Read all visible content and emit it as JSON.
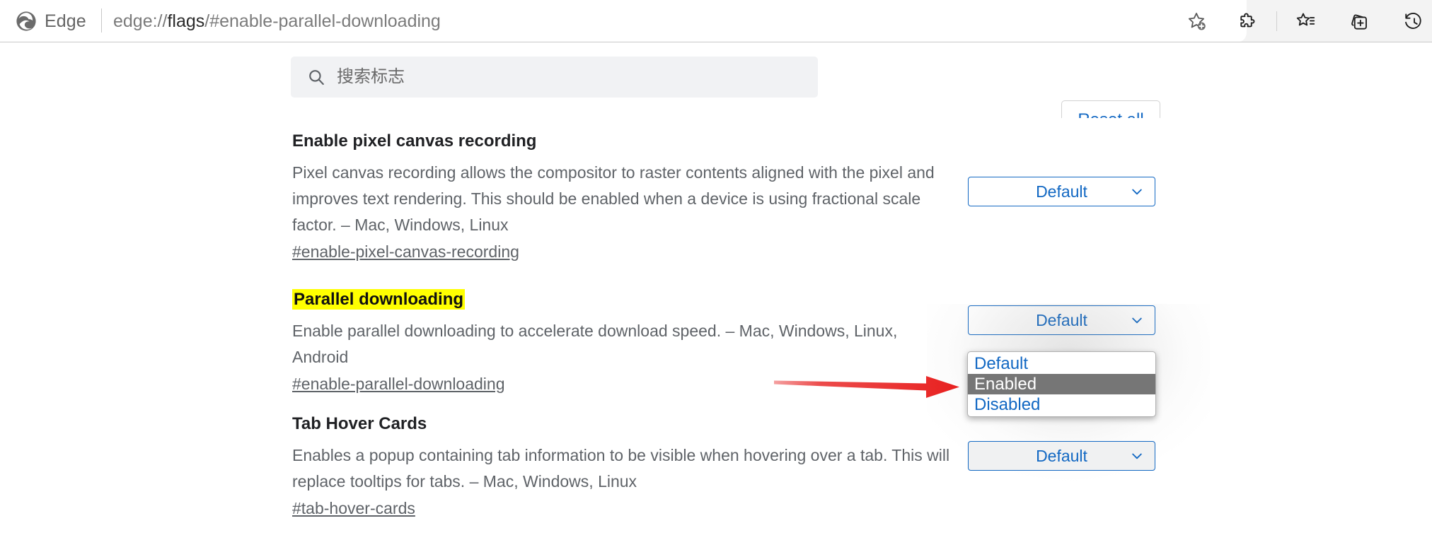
{
  "browser": {
    "name": "Edge",
    "url_prefix": "edge://",
    "url_strong": "flags",
    "url_suffix": "/#enable-parallel-downloading",
    "url_full": "edge://flags/#enable-parallel-downloading",
    "icons": [
      {
        "name": "add-favorite-icon",
        "label": "Add this page to favorites"
      },
      {
        "name": "extensions-icon",
        "label": "Extensions"
      },
      {
        "name": "favorites-icon",
        "label": "Favorites"
      },
      {
        "name": "collections-icon",
        "label": "Collections"
      },
      {
        "name": "history-icon",
        "label": "History"
      }
    ]
  },
  "header": {
    "search_placeholder": "搜索标志",
    "search_value": "",
    "search_icon": "search-icon",
    "reset_all_label": "Reset all"
  },
  "colors": {
    "accent_blue": "#1268c3",
    "highlight_yellow": "#ffff00",
    "option_selected_bg": "#767676",
    "annotation_red": "#e8201f",
    "text_muted": "#5f6368"
  },
  "select_options": [
    "Default",
    "Enabled",
    "Disabled"
  ],
  "flags": [
    {
      "title": "Enable pixel canvas recording",
      "highlighted": false,
      "description": "Pixel canvas recording allows the compositor to raster contents aligned with the pixel and improves text rendering. This should be enabled when a device is using fractional scale factor. – Mac, Windows, Linux",
      "anchor": "#enable-pixel-canvas-recording",
      "select_value": "Default",
      "open": false
    },
    {
      "title": "Parallel downloading",
      "highlighted": true,
      "description": "Enable parallel downloading to accelerate download speed. – Mac, Windows, Linux, Android",
      "anchor": "#enable-parallel-downloading",
      "select_value": "Default",
      "open": true,
      "open_options": [
        "Default",
        "Enabled",
        "Disabled"
      ],
      "highlighted_option": "Enabled"
    },
    {
      "title": "Tab Hover Cards",
      "highlighted": false,
      "description": "Enables a popup containing tab information to be visible when hovering over a tab. This will replace tooltips for tabs. – Mac, Windows, Linux",
      "anchor": "#tab-hover-cards",
      "select_value": "Default",
      "open": false
    }
  ],
  "annotation": {
    "type": "red-arrow",
    "points_to": "Enabled"
  }
}
